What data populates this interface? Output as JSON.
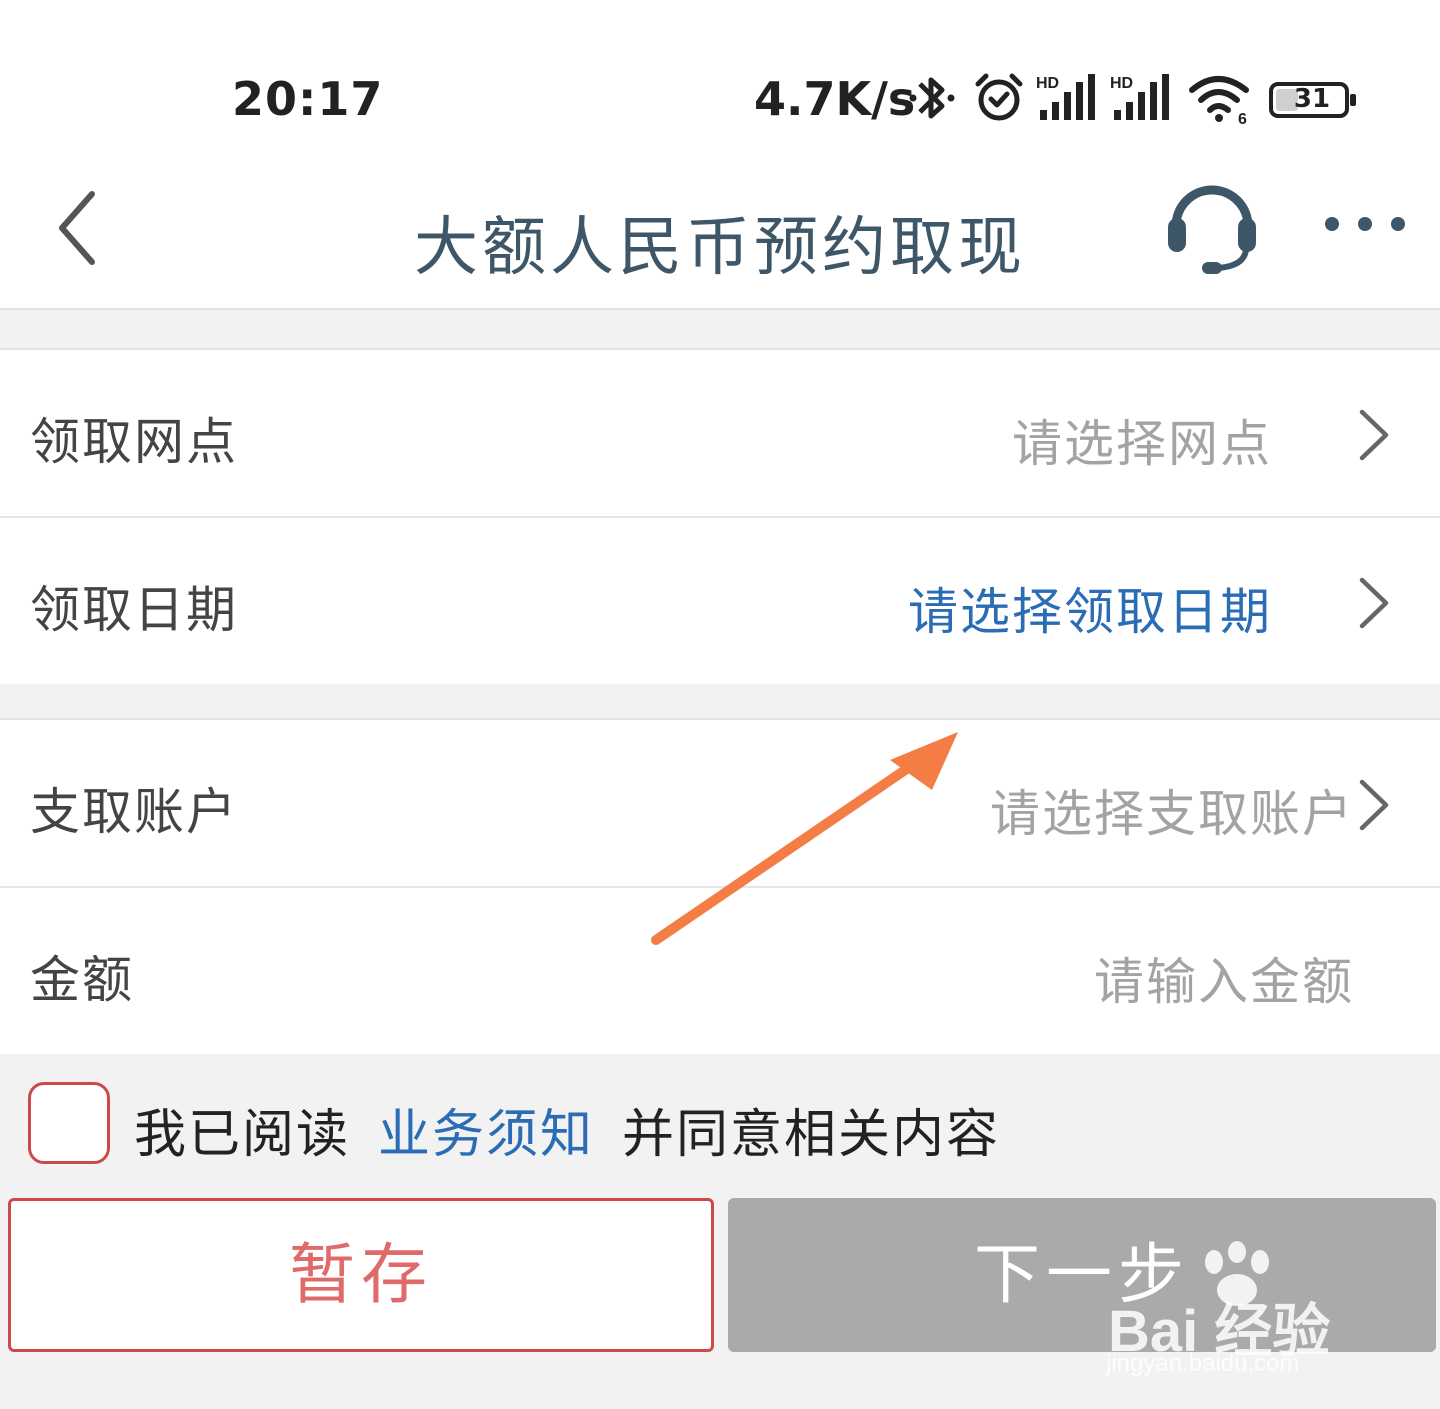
{
  "status_bar": {
    "time": "20:17",
    "network_speed": "4.7K/s",
    "battery": "31",
    "icons": [
      "bluetooth-icon",
      "alarm-icon",
      "signal-hd-icon",
      "signal-hd-icon",
      "wifi-6-icon",
      "battery-icon"
    ]
  },
  "header": {
    "title": "大额人民币预约取现",
    "icons": [
      "back-icon",
      "customer-service-icon",
      "more-icon"
    ]
  },
  "form": {
    "branch": {
      "label": "领取网点",
      "placeholder": "请选择网点"
    },
    "date": {
      "label": "领取日期",
      "value": "请选择领取日期"
    },
    "account": {
      "label": "支取账户",
      "placeholder": "请选择支取账户"
    },
    "amount": {
      "label": "金额",
      "placeholder": "请输入金额"
    }
  },
  "agreement": {
    "prefix": "我已阅读",
    "link": "业务须知",
    "suffix": "并同意相关内容",
    "checked": false
  },
  "buttons": {
    "save": "暂存",
    "next": "下一步"
  },
  "colors": {
    "title": "#3d5668",
    "link_blue": "#2a6cb5",
    "save_red": "#cc4a4a",
    "disabled_gray": "#aaaaaa",
    "annotation_arrow": "#f47c45"
  },
  "watermark": {
    "brand": "Bai 经验",
    "site": "jingyan.baidu.com"
  }
}
